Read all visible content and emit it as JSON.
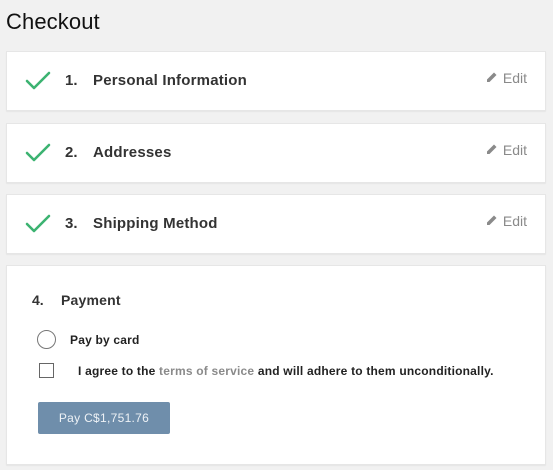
{
  "page": {
    "title": "Checkout"
  },
  "steps": [
    {
      "number": "1.",
      "title": "Personal Information",
      "edit_label": "Edit",
      "status_icon": "check-icon"
    },
    {
      "number": "2.",
      "title": "Addresses",
      "edit_label": "Edit",
      "status_icon": "check-icon"
    },
    {
      "number": "3.",
      "title": "Shipping Method",
      "edit_label": "Edit",
      "status_icon": "check-icon"
    }
  ],
  "payment": {
    "number": "4.",
    "title": "Payment",
    "method_label": "Pay by card",
    "terms_prefix": "I agree to the",
    "terms_link": "terms of service",
    "terms_suffix": "and will adhere to them unconditionally.",
    "pay_button_label": "Pay C$1,751.76"
  },
  "colors": {
    "check_green": "#3cb371",
    "pay_button": "#6f8eab",
    "link_gray": "#8a8a8a"
  }
}
